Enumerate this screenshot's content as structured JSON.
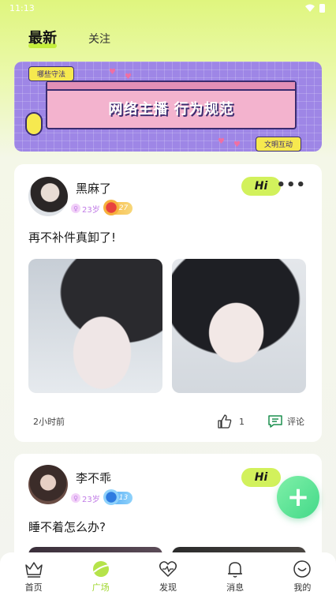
{
  "status_bar": {
    "time": "11:13"
  },
  "tabs": {
    "latest": "最新",
    "follow": "关注"
  },
  "banner": {
    "tag": "哪些守法",
    "title": "网络主播 行为规范",
    "button": "文明互动"
  },
  "posts": [
    {
      "username": "黑麻了",
      "age": "23岁",
      "level": "27",
      "hi": "Hi",
      "text": "再不补件真卸了!",
      "time": "2小时前",
      "likes": "1",
      "comment_label": "评论"
    },
    {
      "username": "李不乖",
      "age": "23岁",
      "level": "13",
      "hi": "Hi",
      "text": "睡不着怎么办?"
    }
  ],
  "fab": {
    "symbol": "+"
  },
  "bottom_nav": [
    {
      "label": "首页",
      "icon": "crown-icon",
      "active": false
    },
    {
      "label": "广场",
      "icon": "planet-icon",
      "active": true
    },
    {
      "label": "发现",
      "icon": "heart-pulse-icon",
      "active": false
    },
    {
      "label": "消息",
      "icon": "bell-icon",
      "active": false
    },
    {
      "label": "我的",
      "icon": "smile-icon",
      "active": false
    }
  ],
  "colors": {
    "accent_green": "#c4ee3b",
    "hi_button": "#d2f15c",
    "fab_green": "#43d989",
    "active_nav": "#9ed62a",
    "banner_purple": "#9e86e6"
  }
}
